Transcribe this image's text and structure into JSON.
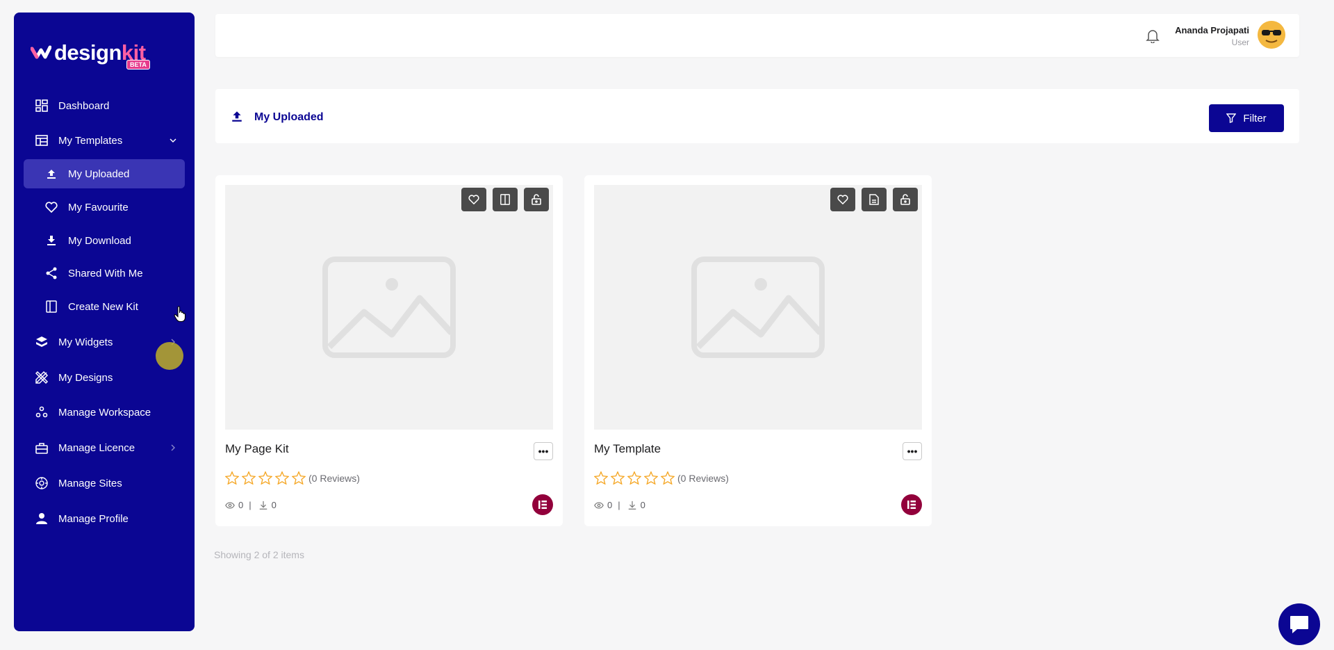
{
  "brand": {
    "name_a": "design",
    "name_b": "kit",
    "badge": "BETA"
  },
  "sidebar": {
    "items": [
      {
        "label": "Dashboard",
        "icon": "grid-icon"
      },
      {
        "label": "My Templates",
        "icon": "template-icon"
      },
      {
        "label": "My Uploaded",
        "icon": "upload-icon"
      },
      {
        "label": "My Favourite",
        "icon": "heart-icon"
      },
      {
        "label": "My Download",
        "icon": "download-icon"
      },
      {
        "label": "Shared With Me",
        "icon": "share-icon"
      },
      {
        "label": "Create New Kit",
        "icon": "book-icon"
      },
      {
        "label": "My Widgets",
        "icon": "layers-icon"
      },
      {
        "label": "My Designs",
        "icon": "pencil-ruler-icon"
      },
      {
        "label": "Manage Workspace",
        "icon": "workspace-icon"
      },
      {
        "label": "Manage Licence",
        "icon": "licence-icon"
      },
      {
        "label": "Manage Sites",
        "icon": "sites-icon"
      },
      {
        "label": "Manage Profile",
        "icon": "user-icon"
      }
    ]
  },
  "header": {
    "user_name": "Ananda Projapati",
    "user_role": "User"
  },
  "section": {
    "title": "My Uploaded",
    "filter_label": "Filter"
  },
  "cards": [
    {
      "title": "My Page Kit",
      "reviews": "(0 Reviews)",
      "views": "0",
      "downloads": "0",
      "separator": "|"
    },
    {
      "title": "My Template",
      "reviews": "(0 Reviews)",
      "views": "0",
      "downloads": "0",
      "separator": "|"
    }
  ],
  "footer": {
    "showing": "Showing 2 of 2 items"
  },
  "colors": {
    "primary": "#0b0693",
    "active": "#3a35b4",
    "star": "#f5a623",
    "elementor": "#92003b"
  }
}
